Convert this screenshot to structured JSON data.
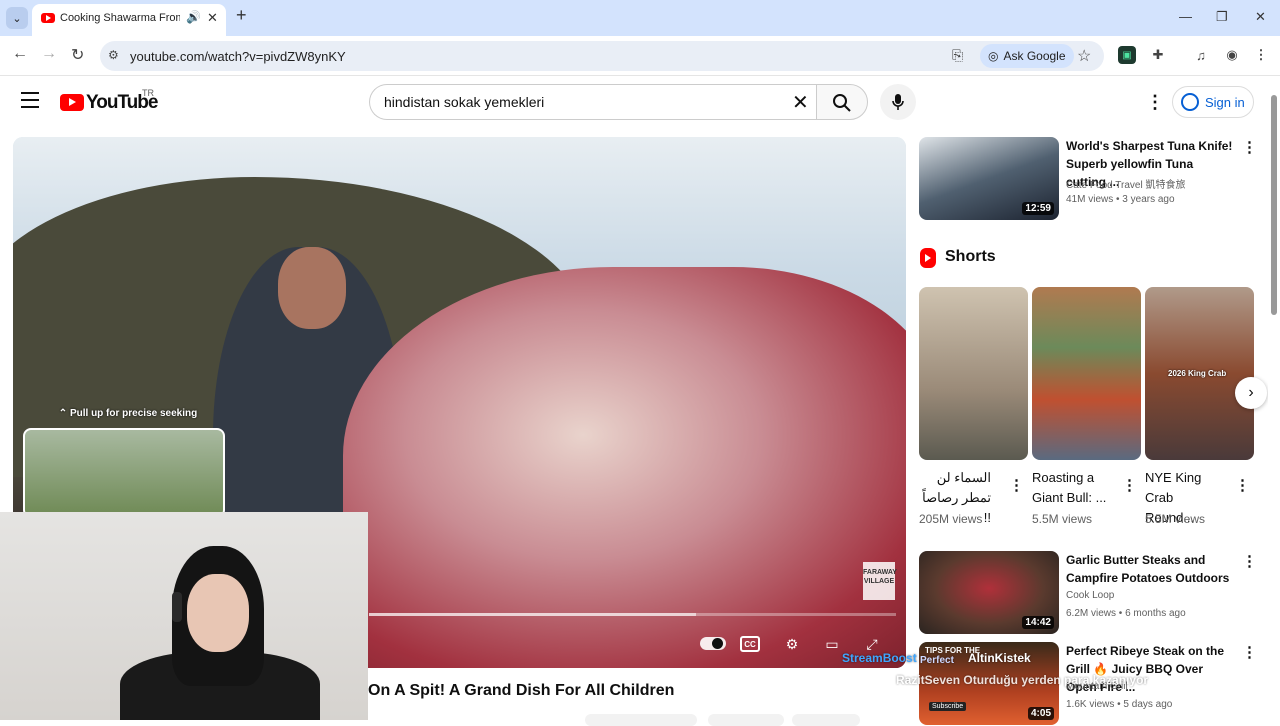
{
  "browser": {
    "tab_title": "Cooking Shawarma From A",
    "url": "youtube.com/watch?v=pivdZW8ynKY",
    "ask_google_label": "Ask Google"
  },
  "header": {
    "logo_text": "YouTube",
    "country_code": "TR",
    "search_query": "hindistan sokak yemekleri",
    "sign_in_label": "Sign in"
  },
  "player": {
    "seek_hint": "Pull up for precise seeking",
    "watermark": "FARAWAY VILLAGE",
    "progress_fraction": 0.62
  },
  "video": {
    "title": "On A Spit! A Grand Dish For All Children"
  },
  "sidebar": {
    "videos": [
      {
        "title": "World's Sharpest Tuna Knife! Superb yellowfin Tuna cutting ...",
        "channel": "Cate Food Travel 凱特食旅",
        "meta": "41M views • 3 years ago",
        "duration": "12:59",
        "thumb_color": "#2b3a4f"
      },
      {
        "title": "Garlic Butter Steaks and Campfire Potatoes Outdoors",
        "channel": "Cook Loop",
        "meta": "6.2M views • 6 months ago",
        "duration": "14:42",
        "thumb_color": "#5a3a2e"
      },
      {
        "title": "Perfect Ribeye Steak on the Grill 🔥 Juicy BBQ Over Open Fire ...",
        "channel": "Mountain Grill",
        "meta": "1.6K views • 5 days ago",
        "duration": "4:05",
        "thumb_color": "#6b2a1a",
        "thumb_text": "TIPS FOR THE"
      }
    ],
    "shorts_heading": "Shorts",
    "shorts": [
      {
        "title": "السماء لن تمطر رصاصاً !!",
        "views": "205M views",
        "thumb_color": "#b8a890"
      },
      {
        "title": "Roasting a Giant Bull: ...",
        "views": "5.5M views",
        "thumb_color": "#8a5a3a"
      },
      {
        "title": "NYE King Crab Round...",
        "views": "5.5M views",
        "thumb_color": "#6a4a3a",
        "thumb_label": "2026 King Crab"
      }
    ]
  },
  "overlay": {
    "line1": "StreamBoost",
    "line2": "Perfect",
    "line3": "AltinKistek",
    "line4": "RazitSeven  Oturduğu yerden para kazanıyor",
    "subscribe": "Subscribe",
    "colors": {
      "blue": "#3ea6ff",
      "white": "#ffffff"
    }
  }
}
